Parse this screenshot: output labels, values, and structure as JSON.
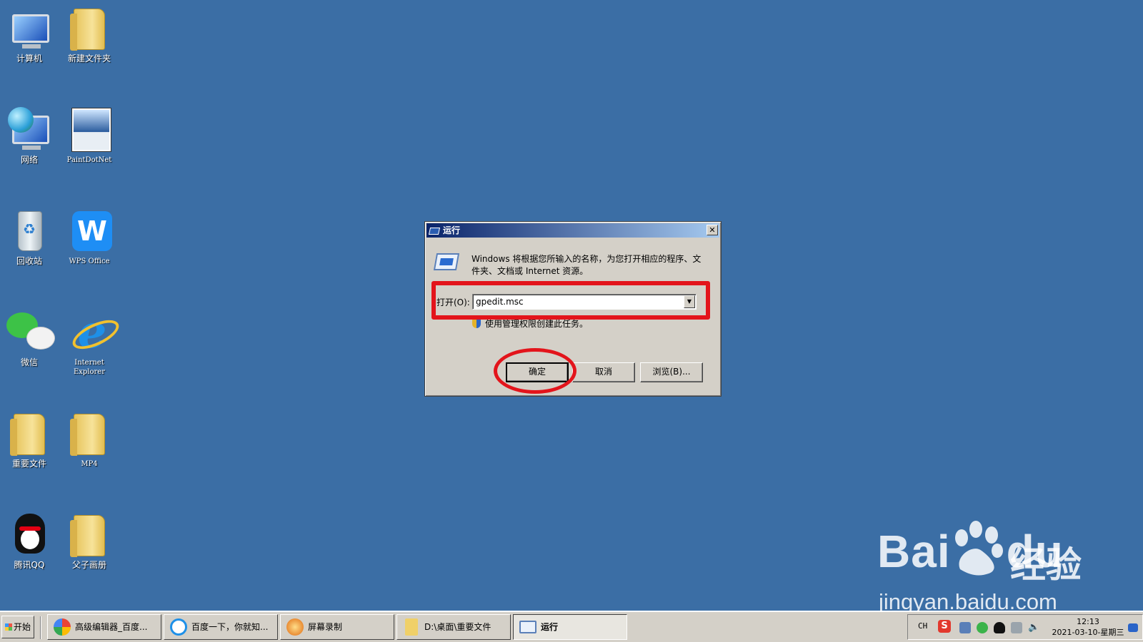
{
  "desktop": {
    "icons": [
      {
        "label": "计算机"
      },
      {
        "label": "新建文件夹"
      },
      {
        "label": "网络"
      },
      {
        "label": "PaintDotNet"
      },
      {
        "label": "回收站"
      },
      {
        "label": "WPS Office"
      },
      {
        "label": "微信"
      },
      {
        "label": "Internet Explorer"
      },
      {
        "label": "重要文件"
      },
      {
        "label": "MP4"
      },
      {
        "label": "腾讯QQ"
      },
      {
        "label": "父子画册"
      }
    ]
  },
  "dialog": {
    "title": "运行",
    "description": "Windows 将根据您所输入的名称，为您打开相应的程序、文件夹、文档或 Internet 资源。",
    "open_label": "打开(O):",
    "open_value": "gpedit.msc",
    "admin_note": "使用管理权限创建此任务。",
    "ok_label": "确定",
    "cancel_label": "取消",
    "browse_label": "浏览(B)...",
    "close_glyph": "✕"
  },
  "watermark": {
    "logo_text": "Bai",
    "logo_du": "du",
    "jingyan": "经验",
    "url": "jingyan.baidu.com"
  },
  "taskbar": {
    "start_label": "开始",
    "items": [
      {
        "label": "高级编辑器_百度..."
      },
      {
        "label": "百度一下，你就知..."
      },
      {
        "label": "屏幕录制"
      },
      {
        "label": "D:\\桌面\\重要文件"
      },
      {
        "label": "运行"
      }
    ],
    "tray": {
      "lang": "CH",
      "time": "12:13",
      "date": "2021-03-10-星期三"
    }
  },
  "colors": {
    "desktop_bg": "#3b6ea5",
    "annotation_red": "#e3141b",
    "titlebar_start": "#0a246a"
  }
}
